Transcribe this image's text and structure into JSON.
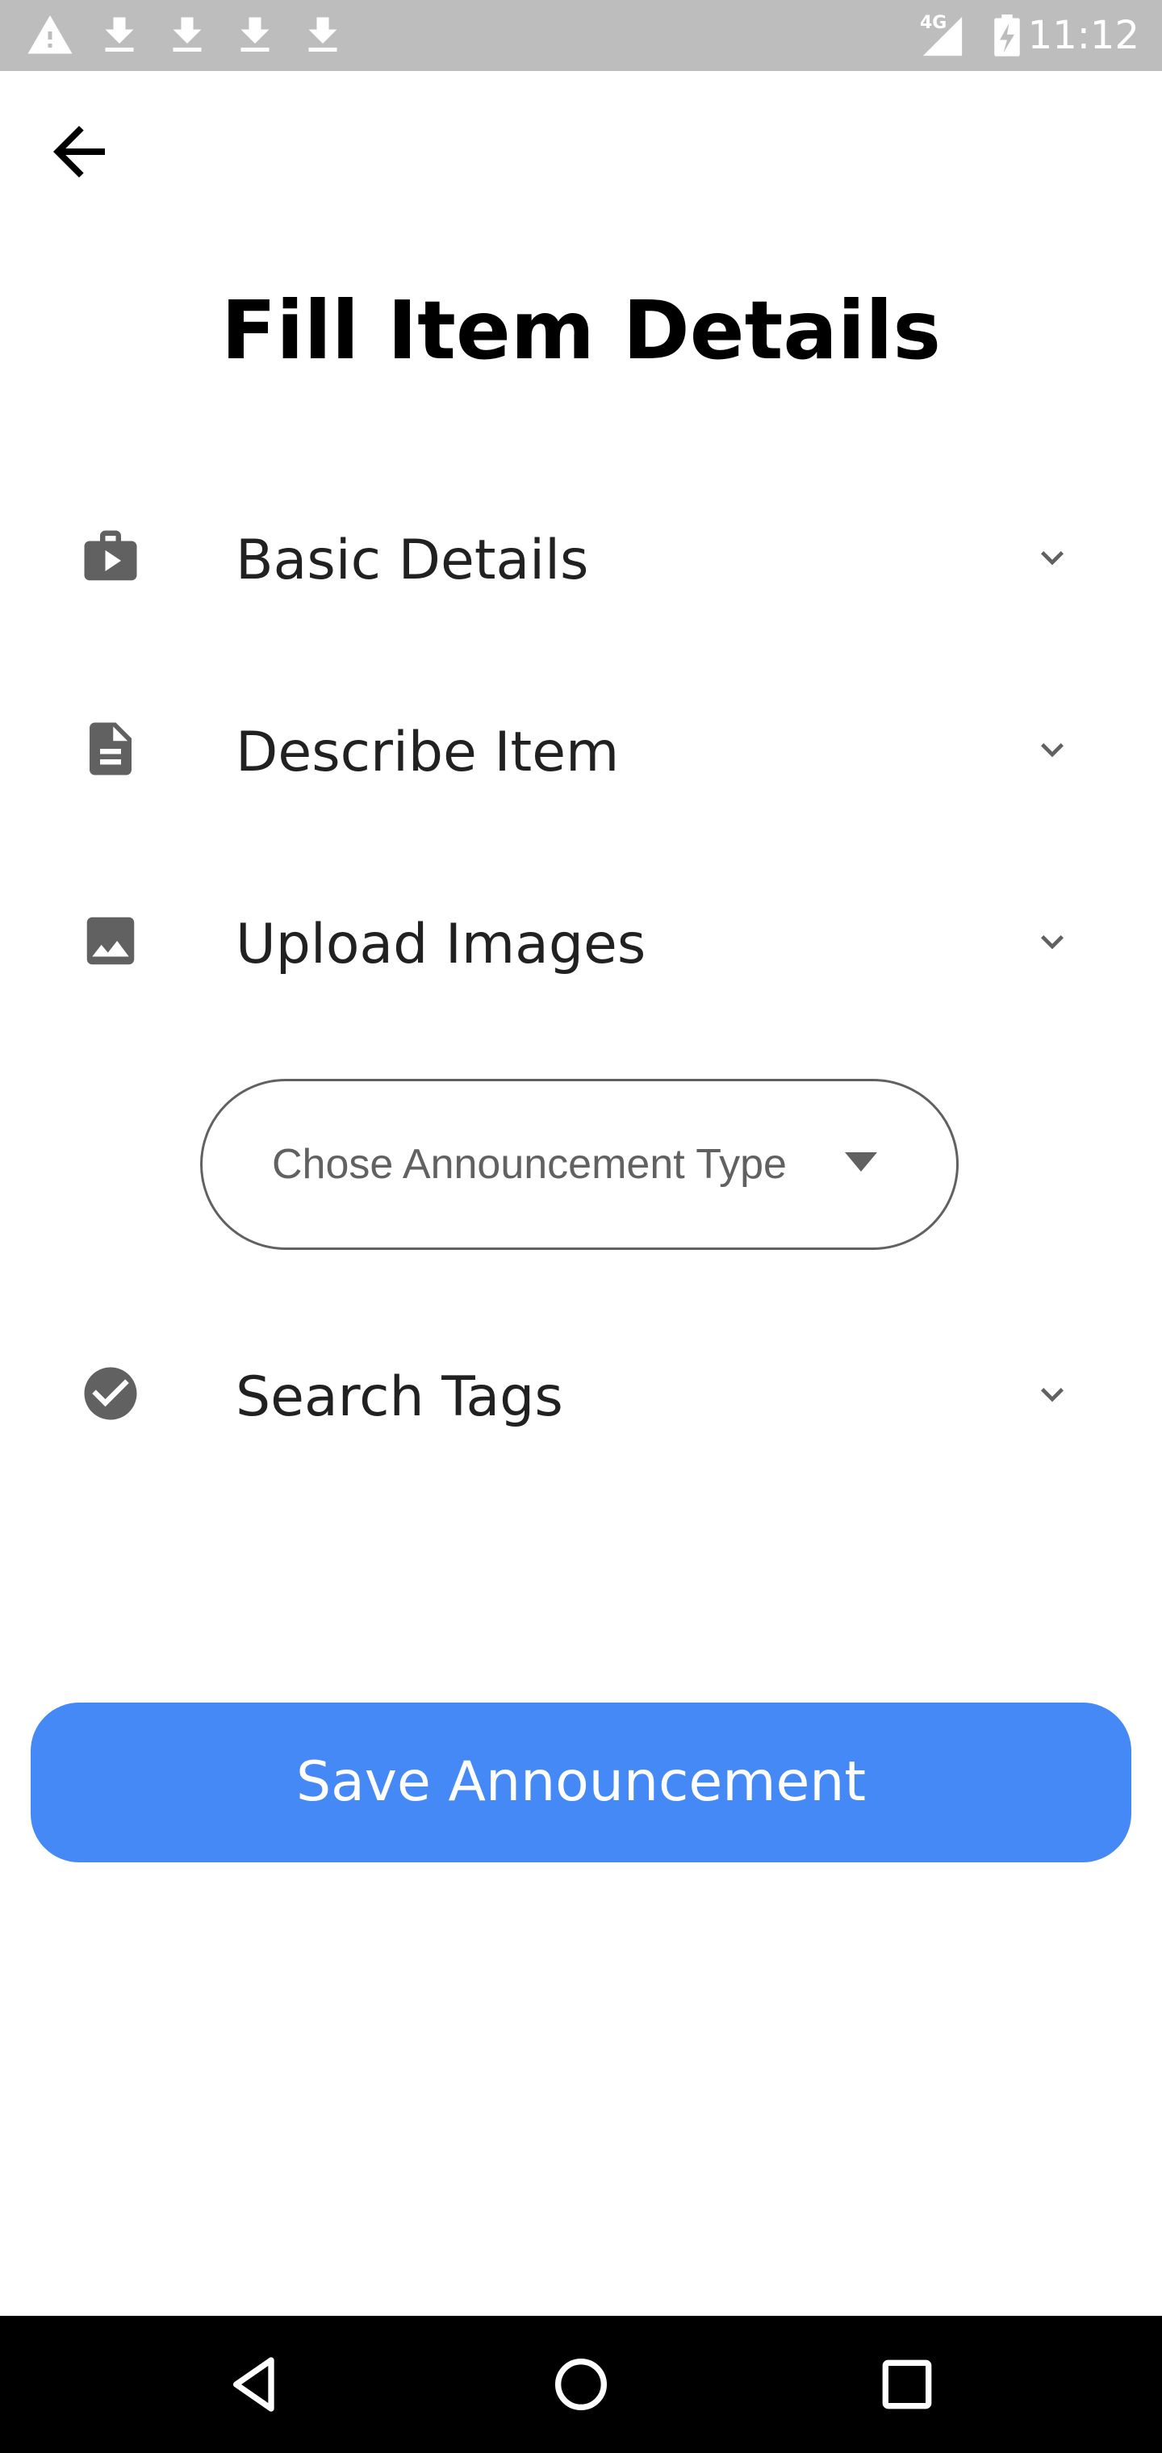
{
  "status_bar": {
    "time": "11:12",
    "network": "4G",
    "notification_icons": [
      "warning-icon",
      "download-icon",
      "download-icon",
      "download-icon",
      "download-icon"
    ]
  },
  "header": {
    "back_icon": "arrow-back-icon",
    "title": "Fill Item Details"
  },
  "sections": [
    {
      "label": "Basic Details",
      "icon": "play-case-icon"
    },
    {
      "label": "Describe Item",
      "icon": "document-icon"
    },
    {
      "label": "Upload Images",
      "icon": "image-icon"
    },
    {
      "label": "Search Tags",
      "icon": "check-circle-icon"
    }
  ],
  "announcement_type": {
    "placeholder": "Chose Announcement Type"
  },
  "save_button": {
    "label": "Save Announcement"
  },
  "colors": {
    "primary": "#4589f7",
    "status_bar": "#bdbdbd",
    "icon_gray": "#616161"
  }
}
